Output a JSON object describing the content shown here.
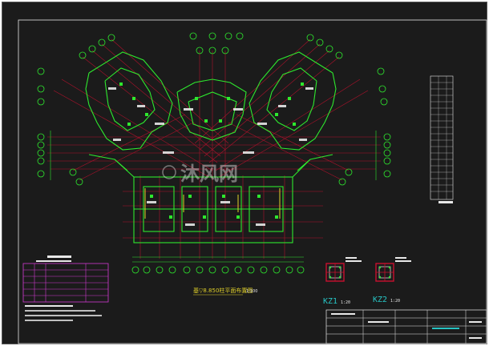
{
  "drawing": {
    "plan_title": "基▽8.850柱平面布置图",
    "plan_scale": "1:100",
    "column_details": [
      {
        "id": "KZ1",
        "scale": "1:20"
      },
      {
        "id": "KZ2",
        "scale": "1:20"
      }
    ],
    "watermark": "沐风网",
    "colors": {
      "background": "#1b1b1b",
      "grid_red": "#c8102e",
      "structure_green": "#2ee82e",
      "text_white": "#e8e8e8",
      "table_magenta": "#d13ad1",
      "accent_cyan": "#27c3c3",
      "annotation_yellow": "#e0d02a"
    }
  }
}
